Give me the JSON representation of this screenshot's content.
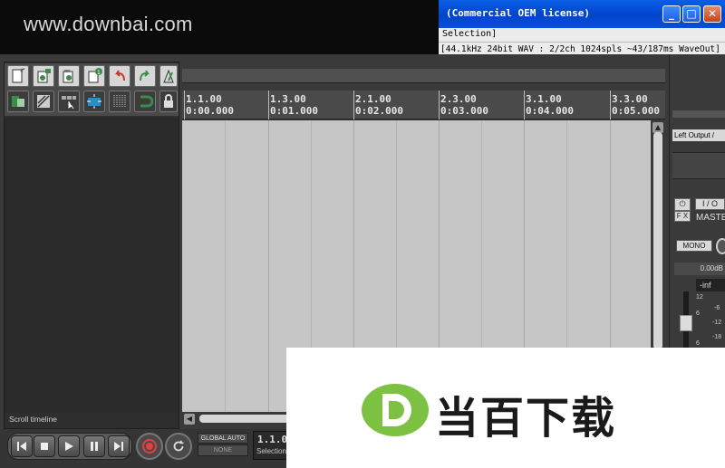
{
  "window": {
    "title": "(Commercial OEM license)",
    "menu_text": "Selection]",
    "status_text": "[44.1kHz 24bit WAV : 2/2ch 1024spls ~43/187ms WaveOut]",
    "buttons": {
      "minimize": "_",
      "maximize": "□",
      "close": "✕"
    }
  },
  "watermark": {
    "top_text": "www.downbai.com",
    "bottom_text": "当百下载",
    "logo_letter": "D",
    "logo_color": "#7cc142"
  },
  "toolbar": {
    "icons": [
      "new-project-icon",
      "open-project-icon",
      "save-project-icon",
      "project-settings-icon",
      "undo-icon",
      "redo-icon",
      "metronome-icon",
      "snap-icon",
      "ripple-edit-icon",
      "grid-icon",
      "envelope-icon",
      "lock-icon-alt",
      "loop-icon",
      "lock-icon"
    ]
  },
  "timeline": {
    "marks": [
      {
        "bar": "1.1.00",
        "time": "0:00.000"
      },
      {
        "bar": "1.3.00",
        "time": "0:01.000"
      },
      {
        "bar": "2.1.00",
        "time": "0:02.000"
      },
      {
        "bar": "2.3.00",
        "time": "0:03.000"
      },
      {
        "bar": "3.1.00",
        "time": "0:04.000"
      },
      {
        "bar": "3.3.00",
        "time": "0:05.000"
      }
    ]
  },
  "tracks": {
    "scroll_label": "Scroll timeline"
  },
  "mixer": {
    "output": "Left Output /",
    "fx_label": "F X",
    "io_label": "I / O",
    "master_label": "MASTER",
    "mono_label": "MONO",
    "volume": "0.00dB",
    "peak": "-inf",
    "scale": [
      "12",
      "6",
      "0",
      "6",
      "-6",
      "-12",
      "-18"
    ]
  },
  "transport": {
    "global_auto": "GLOBAL AUTO",
    "global_none": "NONE",
    "position": "1.1.00",
    "selection_label": "Selection"
  }
}
